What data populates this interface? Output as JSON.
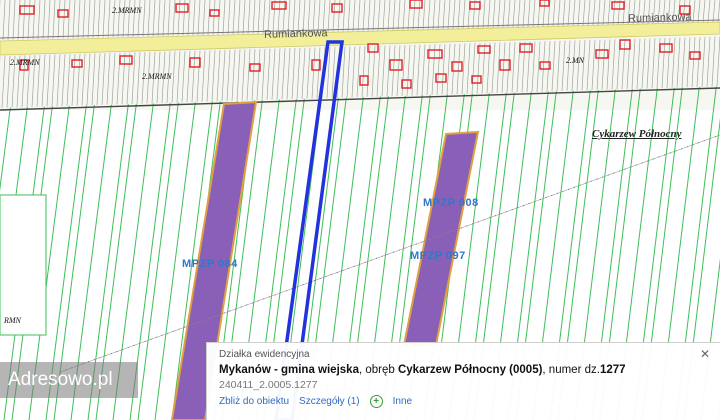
{
  "map": {
    "street_labels": [
      "Rumiankowa",
      "Rumiankowa"
    ],
    "region_label": "Cykarzew Północny",
    "zone_labels": [
      "MPZP 084",
      "MPZP 008",
      "MPZP 097"
    ],
    "small_labels": [
      "2.MRMN",
      "2.MRMN",
      "2.MRMN",
      "2.MN",
      "RMN"
    ],
    "colors": {
      "parcel_lines": "#3fbf5a",
      "buildings": "#e0202a",
      "zones": "#8a5fb8",
      "zone_border": "#e0a040",
      "selection": "#2233dd",
      "road": "#f2ee9a",
      "mpzp_text": "#2f78c9"
    }
  },
  "popup": {
    "title": "Działka ewidencyjna",
    "gmina": "Mykanów - gmina wiejska",
    "obreb_prefix": ", obręb ",
    "obreb": "Cykarzew Północny (0005)",
    "numer_prefix": ", numer dz.",
    "numer": "1277",
    "id": "240411_2.0005.1277",
    "links": {
      "zoom": "Zbliż do obiektu",
      "details": "Szczegóły (1)",
      "other": "Inne"
    },
    "close_icon": "✕"
  },
  "brand": {
    "text": "Adresowo.pl"
  }
}
